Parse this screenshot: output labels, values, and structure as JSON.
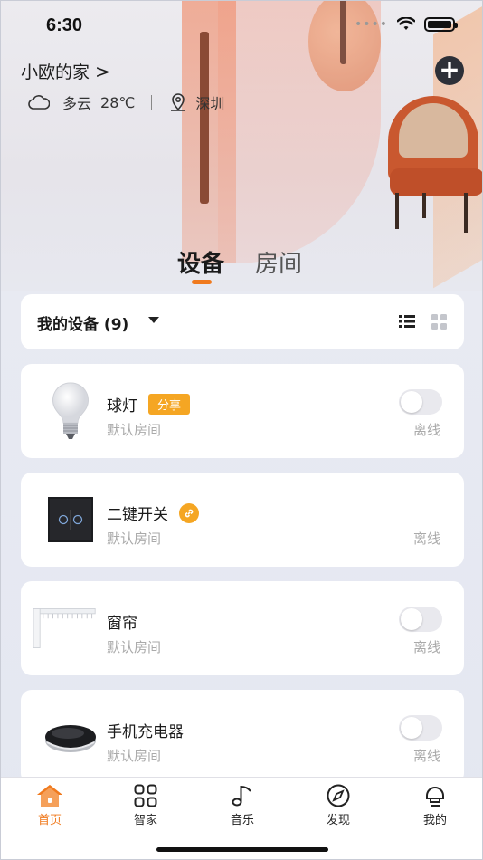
{
  "status_bar": {
    "time": "6:30"
  },
  "header": {
    "home_name": "小欧的家",
    "chevron": ">",
    "weather_condition": "多云",
    "temperature": "28℃",
    "city": "深圳"
  },
  "tabs": [
    {
      "label": "设备",
      "active": true
    },
    {
      "label": "房间",
      "active": false
    }
  ],
  "filter": {
    "label": "我的设备 (9)"
  },
  "devices": [
    {
      "name": "球灯",
      "badge": "分享",
      "room": "默认房间",
      "status": "离线",
      "toggle": "off"
    },
    {
      "name": "二键开关",
      "room": "默认房间",
      "status": "离线"
    },
    {
      "name": "窗帘",
      "room": "默认房间",
      "status": "离线",
      "toggle": "off"
    },
    {
      "name": "手机充电器",
      "room": "默认房间",
      "status": "离线",
      "toggle": "off"
    }
  ],
  "bottom_nav": [
    {
      "label": "首页",
      "icon": "home-icon",
      "active": true
    },
    {
      "label": "智家",
      "icon": "grid-icon",
      "active": false
    },
    {
      "label": "音乐",
      "icon": "music-note-icon",
      "active": false
    },
    {
      "label": "发现",
      "icon": "compass-icon",
      "active": false
    },
    {
      "label": "我的",
      "icon": "profile-icon",
      "active": false
    }
  ],
  "colors": {
    "accent": "#f07a1e",
    "badge": "#f5a623"
  }
}
